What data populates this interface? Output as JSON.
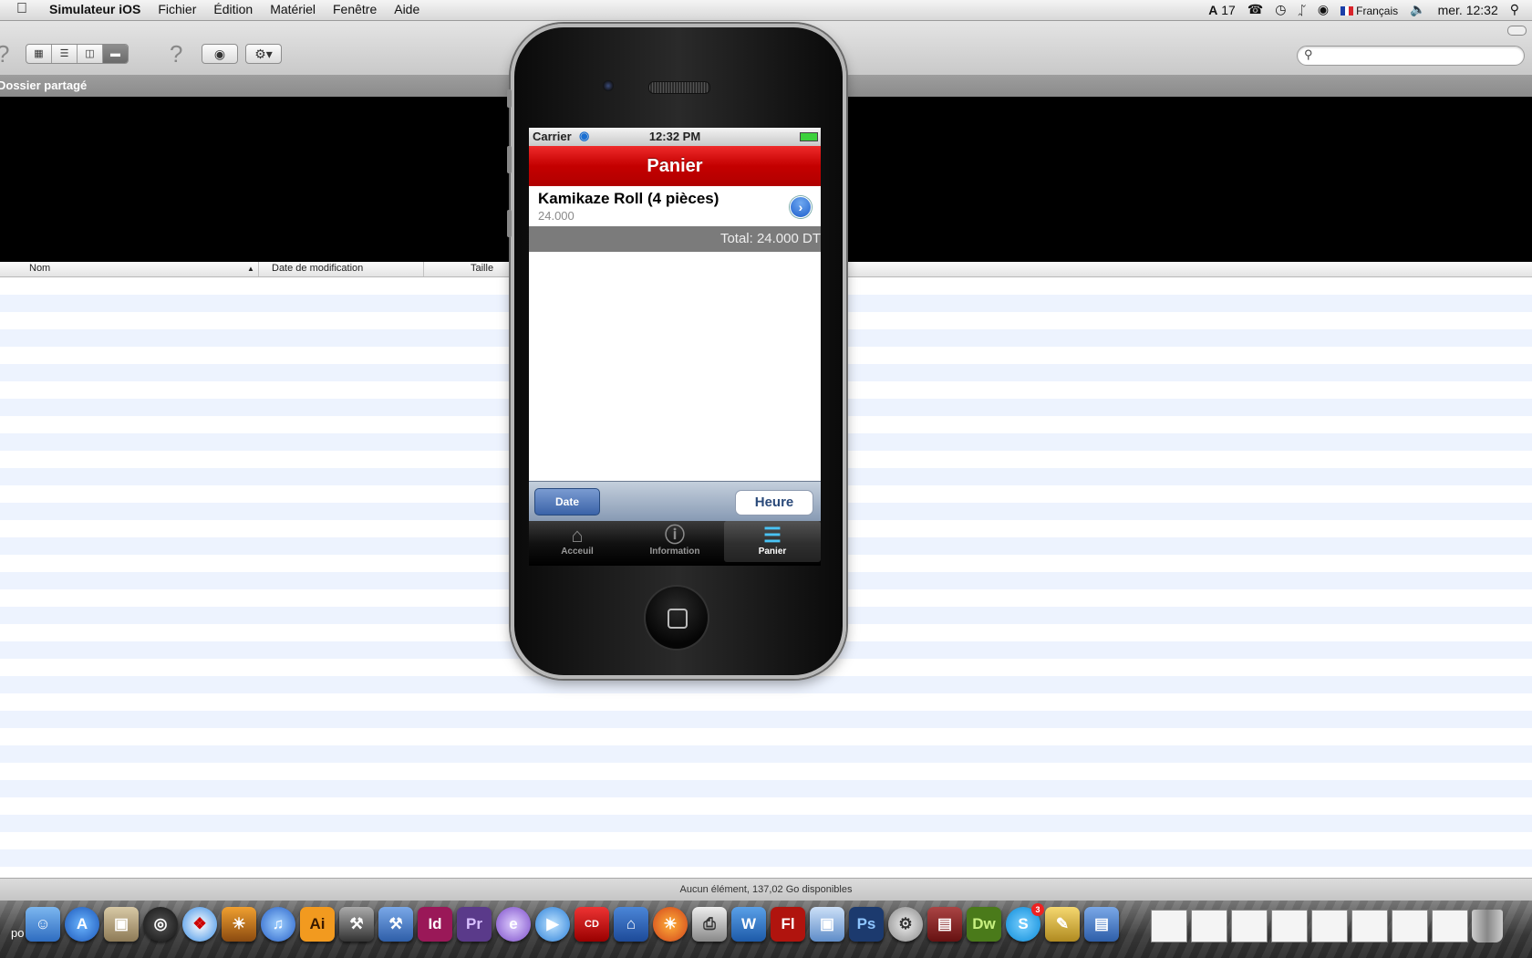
{
  "menubar": {
    "app_name": "Simulateur iOS",
    "menus": [
      "Fichier",
      "Édition",
      "Matériel",
      "Fenêtre",
      "Aide"
    ],
    "status": {
      "adobe_count": "17",
      "input_source": "Français",
      "clock": "mer. 12:32"
    }
  },
  "finder": {
    "path_title": "Dossier partagé",
    "columns": [
      "Nom",
      "Date de modification",
      "Taille"
    ],
    "status_text": "Aucun élément, 137,02 Go disponibles"
  },
  "iphone": {
    "status_bar": {
      "carrier": "Carrier",
      "time": "12:32 PM"
    },
    "nav_title": "Panier",
    "cart_item": {
      "title": "Kamikaze Roll (4 pièces)",
      "price": "24.000"
    },
    "total": "Total: 24.000 DT",
    "picker": {
      "date_label": "Date",
      "heure_label": "Heure"
    },
    "tabs": [
      {
        "label": "Acceuil",
        "icon": "home-icon"
      },
      {
        "label": "Information",
        "icon": "info-icon"
      },
      {
        "label": "Panier",
        "icon": "basket-icon",
        "active": true
      }
    ]
  },
  "dock": {
    "partial_label": "po",
    "apps": [
      "Finder",
      "App Store",
      "Aperçu",
      "Dashboard",
      "Safari",
      "iPhoto",
      "iTunes",
      "Ai",
      "Utilitaires",
      "Xcode",
      "Id",
      "Pr",
      "Eclipse",
      "QuickTime",
      "Prinet CD",
      "Home",
      "Firefox",
      "Imprimante",
      "Dossiers",
      "Fl",
      "Aperçu 2",
      "Ps",
      "Utilitaires 2",
      "Pdf",
      "Dw",
      "Skype",
      "Instruments",
      "Fichiers"
    ],
    "skype_badge": "3"
  },
  "colors": {
    "nav_red": "#c40000",
    "tab_active": "#49c3f5",
    "row_stripe": "#edf3fe"
  }
}
